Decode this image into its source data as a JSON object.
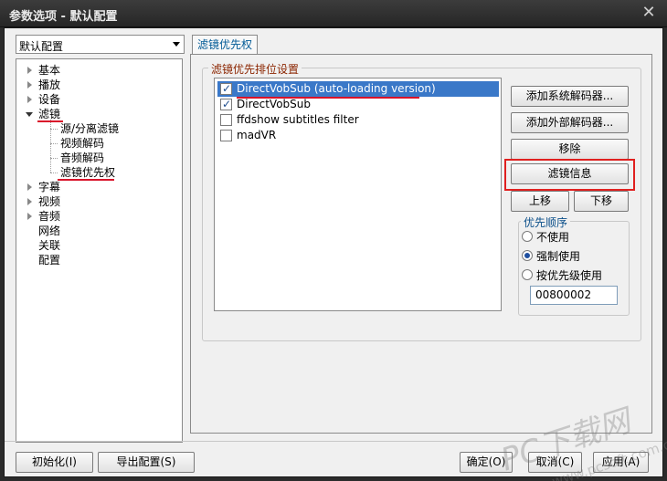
{
  "window": {
    "title": "参数选项 - 默认配置",
    "close_glyph": "✕"
  },
  "preset": {
    "value": "默认配置"
  },
  "tree": {
    "items": [
      {
        "label": "基本",
        "state": "closed"
      },
      {
        "label": "播放",
        "state": "closed"
      },
      {
        "label": "设备",
        "state": "closed"
      },
      {
        "label": "滤镜",
        "state": "open"
      },
      {
        "label": "源/分离滤镜",
        "state": "child"
      },
      {
        "label": "视频解码",
        "state": "child"
      },
      {
        "label": "音频解码",
        "state": "child"
      },
      {
        "label": "滤镜优先权",
        "state": "child-selected"
      },
      {
        "label": "字幕",
        "state": "closed"
      },
      {
        "label": "视频",
        "state": "closed"
      },
      {
        "label": "音频",
        "state": "closed"
      },
      {
        "label": "网络",
        "state": "leaf"
      },
      {
        "label": "关联",
        "state": "leaf"
      },
      {
        "label": "配置",
        "state": "leaf"
      }
    ]
  },
  "tab": {
    "label": "滤镜优先权"
  },
  "filter_group": {
    "title": "滤镜优先排位设置"
  },
  "filters": [
    {
      "name": "DirectVobSub (auto-loading version)",
      "checked": true,
      "selected": true
    },
    {
      "name": "DirectVobSub",
      "checked": true,
      "selected": false
    },
    {
      "name": "ffdshow subtitles filter",
      "checked": false,
      "selected": false
    },
    {
      "name": "madVR",
      "checked": false,
      "selected": false
    }
  ],
  "buttons": {
    "add_system": "添加系统解码器...",
    "add_external": "添加外部解码器...",
    "remove": "移除",
    "filter_info": "滤镜信息",
    "move_up": "上移",
    "move_down": "下移"
  },
  "priority": {
    "title": "优先顺序",
    "options": [
      "不使用",
      "强制使用",
      "按优先级使用"
    ],
    "selected_index": 1,
    "value": "00800002"
  },
  "footer": {
    "reset": "初始化(I)",
    "export": "导出配置(S)",
    "ok": "确定(O)",
    "cancel": "取消(C)",
    "apply": "应用(A)"
  },
  "watermark": {
    "text": "PC下载网",
    "sub": "www.pcsoft.com.cn"
  },
  "colors": {
    "accent_red": "#e0201f",
    "selection_blue": "#3a78c8",
    "group_title": "#8b2500"
  }
}
